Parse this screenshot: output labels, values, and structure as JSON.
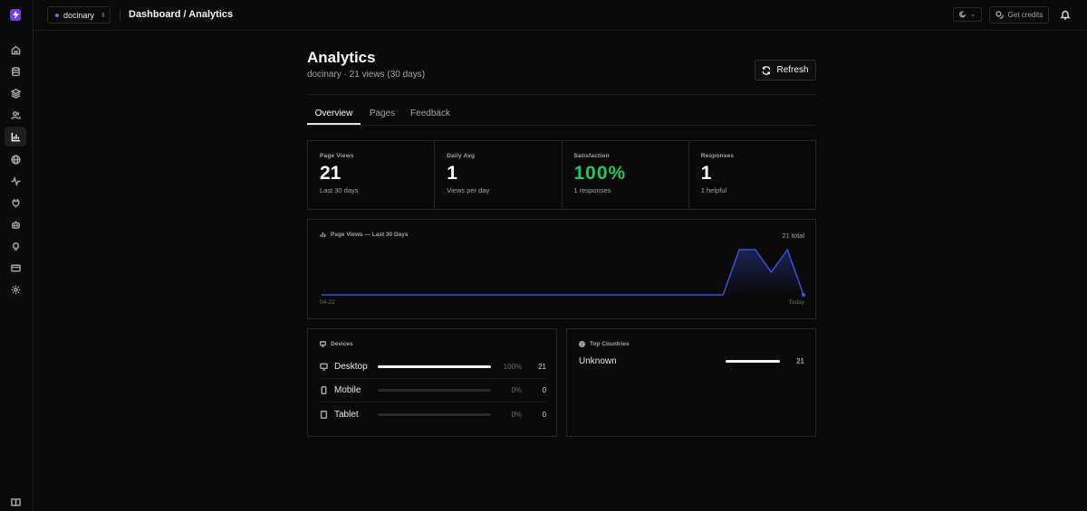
{
  "workspace": {
    "name": "docinary"
  },
  "header": {
    "breadcrumb": "Dashboard / Analytics",
    "credits_label": "Get credits"
  },
  "page": {
    "title": "Analytics",
    "subtitle": "docinary · 21 views (30 days)",
    "refresh_label": "Refresh"
  },
  "tabs": [
    {
      "label": "Overview",
      "active": true
    },
    {
      "label": "Pages",
      "active": false
    },
    {
      "label": "Feedback",
      "active": false
    }
  ],
  "stats": [
    {
      "label": "Page Views",
      "value": "21",
      "sub": "Last 30 days"
    },
    {
      "label": "Daily Avg",
      "value": "1",
      "sub": "Views per day"
    },
    {
      "label": "Satisfaction",
      "value": "100%",
      "sub": "1 responses",
      "color": "#22c55e"
    },
    {
      "label": "Responses",
      "value": "1",
      "sub": "1 helpful"
    }
  ],
  "chart": {
    "title": "Page Views — Last 30 Days",
    "total_label": "21 total",
    "x_start": "04-22",
    "x_end": "Today"
  },
  "chart_data": {
    "type": "area",
    "title": "Page Views — Last 30 Days",
    "x_labels": [
      "04-22",
      "Today"
    ],
    "values": [
      0,
      0,
      0,
      0,
      0,
      0,
      0,
      0,
      0,
      0,
      0,
      0,
      0,
      0,
      0,
      0,
      0,
      0,
      0,
      0,
      0,
      0,
      0,
      0,
      0,
      0,
      8,
      8,
      4,
      8,
      0
    ],
    "color": "#3b52e0",
    "grid": false
  },
  "devices": {
    "title": "Devices",
    "rows": [
      {
        "name": "Desktop",
        "pct": "100%",
        "count": "21",
        "fraction": 1.0
      },
      {
        "name": "Mobile",
        "pct": "0%",
        "count": "0",
        "fraction": 0
      },
      {
        "name": "Tablet",
        "pct": "0%",
        "count": "0",
        "fraction": 0
      }
    ]
  },
  "countries": {
    "title": "Top Countries",
    "rows": [
      {
        "name": "Unknown",
        "count": "21",
        "fraction": 1.0
      }
    ]
  },
  "colors": {
    "accent": "#7c3aed",
    "chart_line": "#3b52e0",
    "success": "#22c55e"
  }
}
